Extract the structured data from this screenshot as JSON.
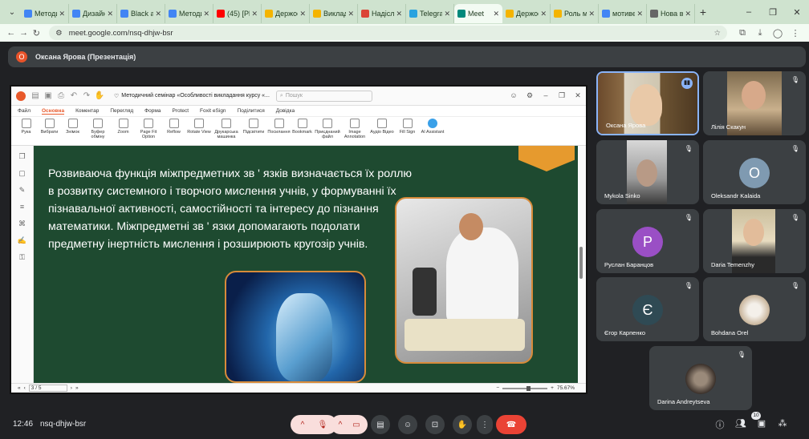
{
  "browser": {
    "tabs": [
      {
        "label": "Методи",
        "color": "#4285f4"
      },
      {
        "label": "Дизайн",
        "color": "#4285f4"
      },
      {
        "label": "Black an",
        "color": "#4285f4"
      },
      {
        "label": "Методи",
        "color": "#4285f4"
      },
      {
        "label": "(45) [Pla",
        "color": "#ff0000"
      },
      {
        "label": "Держос",
        "color": "#f4b400"
      },
      {
        "label": "Викладі",
        "color": "#f4b400"
      },
      {
        "label": "Надісло",
        "color": "#db4437"
      },
      {
        "label": "Telegram",
        "color": "#2aa3df"
      },
      {
        "label": "Meet",
        "color": "#00897b"
      },
      {
        "label": "Держос",
        "color": "#f4b400"
      },
      {
        "label": "Роль м",
        "color": "#f4b400"
      },
      {
        "label": "мотиве",
        "color": "#4285f4"
      },
      {
        "label": "Нова вк",
        "color": "#666666"
      }
    ],
    "active_tab_index": 9,
    "url": "meet.google.com/nsq-dhjw-bsr",
    "new_tab": "+",
    "controls": {
      "minimize": "–",
      "maximize": "❐",
      "close": "✕"
    },
    "nav": {
      "back": "←",
      "forward": "→",
      "reload": "↻"
    }
  },
  "presenter": {
    "initial": "О",
    "label": "Оксана Ярова (Презентація)"
  },
  "foxit": {
    "doc_title": "Методичний семінар «Особливості викладання курсу «...",
    "search_placeholder": "Пошук",
    "menu": [
      "Файл",
      "Основна",
      "Коментар",
      "Перегляд",
      "Форма",
      "Protect",
      "Foxit eSign",
      "Поділитися",
      "Довідка"
    ],
    "active_menu": 1,
    "ribbon": [
      "Рука",
      "Вибрати",
      "Знімок",
      "Буфер обміну",
      "Zoom",
      "Page Fit Option",
      "Reflow",
      "Rotate View",
      "Друкарська машинка",
      "Підсвітити",
      "Посилання",
      "Bookmark",
      "Приєднаний файл",
      "Image Annotation",
      "Аудіо Відео",
      "Fill Sign",
      "AI Assistant"
    ],
    "page_indicator": "3 / 5",
    "zoom": "75.67%"
  },
  "slide": {
    "text": "Розвиваюча функція міжпредметних зв ' язків визначається їх роллю в розвитку системного і творчого мислення учнів, у формуванні їх пізнавальної активності, самостійності та інтересу до пізнання математики. Міжпредметні зв ' язки допомагають подолати предметну інертність мислення і розширюють кругозір учнів.",
    "bg_color": "#1e4a30",
    "accent_color": "#e69a2e"
  },
  "participants": [
    {
      "name": "Оксана Ярова",
      "type": "video",
      "speaking": true
    },
    {
      "name": "Лілія Скакун",
      "type": "video",
      "muted": true
    },
    {
      "name": "Mykola Sinko",
      "type": "video",
      "muted": true
    },
    {
      "name": "Oleksandr Kalaida",
      "initial": "O",
      "color": "#7f9ab1",
      "muted": true
    },
    {
      "name": "Руслан Баранцов",
      "initial": "P",
      "color": "#9a4fc5",
      "muted": true
    },
    {
      "name": "Daria Temenzhy",
      "type": "video",
      "muted": true
    },
    {
      "name": "Єгор Карпенко",
      "initial": "Є",
      "color": "#2f4a54",
      "muted": true
    },
    {
      "name": "Bohdana Orel",
      "type": "avatar",
      "muted": true
    },
    {
      "name": "Darina Andreytseva",
      "type": "avatar",
      "muted": true
    }
  ],
  "bottom": {
    "time": "12:46",
    "meeting_code": "nsq-dhjw-bsr",
    "people_count": "10"
  }
}
